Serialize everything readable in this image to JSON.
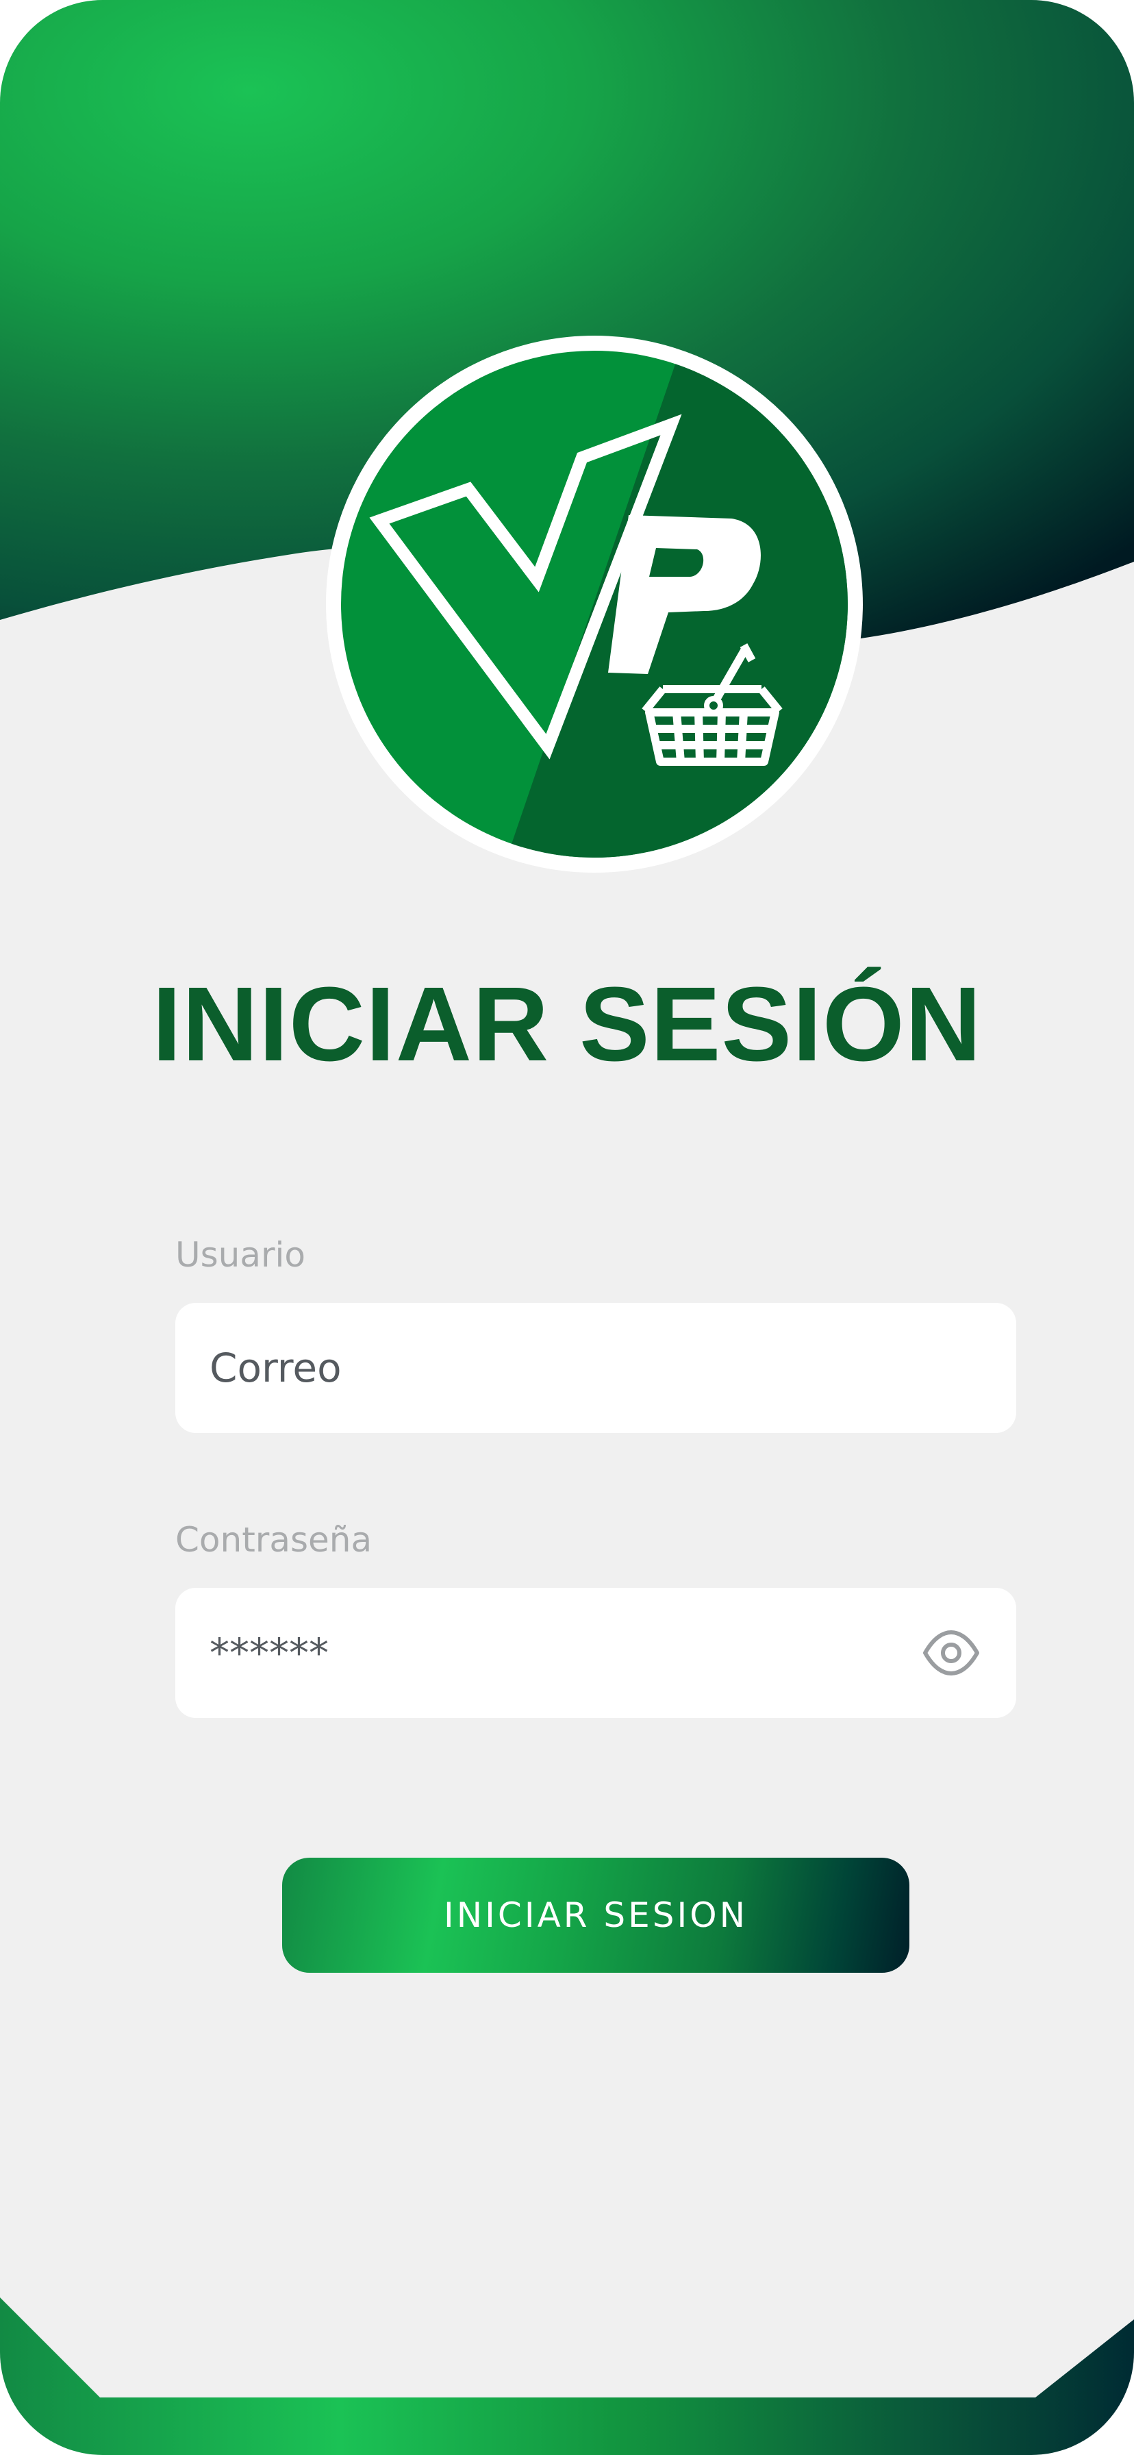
{
  "screen": {
    "title": "INICIAR SESIÓN"
  },
  "form": {
    "username": {
      "label": "Usuario",
      "placeholder": "Correo",
      "value": ""
    },
    "password": {
      "label": "Contraseña",
      "placeholder": "******",
      "value": ""
    },
    "submit_label": "INICIAR SESION"
  },
  "icons": {
    "logo": "vp-basket-logo",
    "visibility": "eye-icon"
  },
  "colors": {
    "primary_green": "#0b5e2c",
    "accent_green": "#1bc255",
    "dark_teal": "#002b33",
    "background": "#f0f0f0",
    "label_gray": "#a9abad"
  }
}
